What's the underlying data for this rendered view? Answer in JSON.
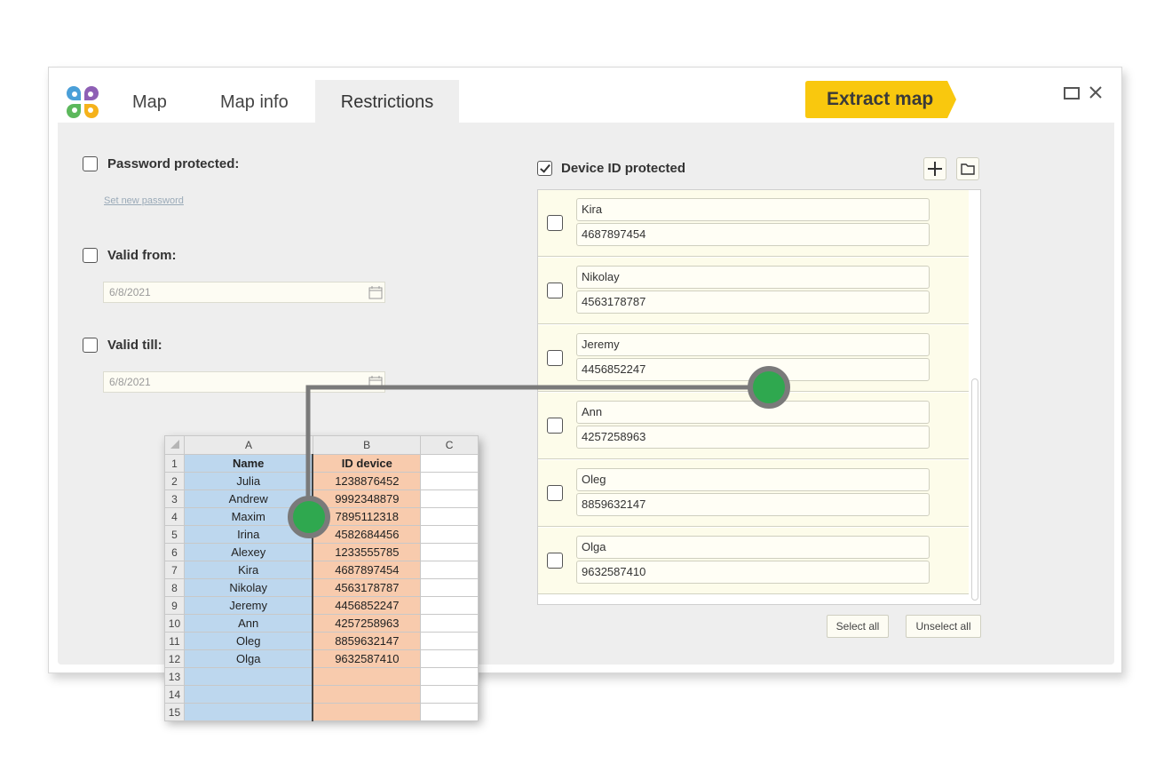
{
  "tabs": [
    {
      "label": "Map"
    },
    {
      "label": "Map info"
    },
    {
      "label": "Restrictions"
    }
  ],
  "extract_button": "Extract map",
  "left_panel": {
    "password": {
      "label": "Password protected:",
      "link": "Set new password"
    },
    "valid_from": {
      "label": "Valid from:",
      "date": "6/8/2021"
    },
    "valid_till": {
      "label": "Valid till:",
      "date": "6/8/2021"
    }
  },
  "device_panel": {
    "label": "Device ID protected",
    "devices": [
      {
        "name": "Kira",
        "id": "4687897454"
      },
      {
        "name": "Nikolay",
        "id": "4563178787"
      },
      {
        "name": "Jeremy",
        "id": "4456852247"
      },
      {
        "name": "Ann",
        "id": "4257258963"
      },
      {
        "name": "Oleg",
        "id": "8859632147"
      },
      {
        "name": "Olga",
        "id": "9632587410"
      }
    ],
    "select_all": "Select all",
    "unselect_all": "Unselect all"
  },
  "spreadsheet": {
    "columns": [
      "A",
      "B",
      "C"
    ],
    "header": [
      "Name",
      "ID device"
    ],
    "row_numbers": [
      "1",
      "2",
      "3",
      "4",
      "5",
      "6",
      "7",
      "8",
      "9",
      "10",
      "11",
      "12",
      "13",
      "14",
      "15"
    ],
    "rows": [
      [
        "Julia",
        "1238876452"
      ],
      [
        "Andrew",
        "9992348879"
      ],
      [
        "Maxim",
        "7895112318"
      ],
      [
        "Irina",
        "4582684456"
      ],
      [
        "Alexey",
        "1233555785"
      ],
      [
        "Kira",
        "4687897454"
      ],
      [
        "Nikolay",
        "4563178787"
      ],
      [
        "Jeremy",
        "4456852247"
      ],
      [
        "Ann",
        "4257258963"
      ],
      [
        "Oleg",
        "8859632147"
      ],
      [
        "Olga",
        "9632587410"
      ],
      [
        "",
        ""
      ],
      [
        "",
        ""
      ],
      [
        "",
        ""
      ]
    ]
  },
  "colors": {
    "accent": "#f9c80e",
    "name_column": "#bdd7ee",
    "id_column": "#f8cbad",
    "connector": "#2fa84f"
  }
}
